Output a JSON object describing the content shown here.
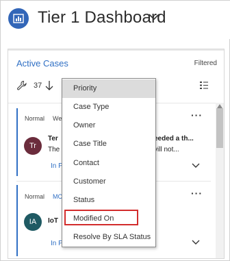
{
  "header": {
    "title": "Tier 1 Dashboard"
  },
  "panel": {
    "title": "Active Cases",
    "filter_status": "Filtered",
    "toolbar": {
      "record_count": "37"
    }
  },
  "cards": [
    {
      "priority": "Normal",
      "owner_fragment": "We",
      "avatar_initials": "Tr",
      "line1_left": "Ter",
      "line1_right": "eeded a th...",
      "line2_left": "The",
      "line2_right": "vill not...",
      "status_fragment": "In P"
    },
    {
      "priority": "Normal",
      "owner_fragment": "MC",
      "avatar_initials": "IA",
      "line1_left": "IoT",
      "status_fragment": "In P"
    }
  ],
  "sort_menu": {
    "items": [
      "Priority",
      "Case Type",
      "Owner",
      "Case Title",
      "Contact",
      "Customer",
      "Status",
      "Modified On",
      "Resolve By SLA Status"
    ],
    "selected_item": "Priority",
    "highlighted_item": "Modified On"
  },
  "colors": {
    "accent": "#2f6fc4",
    "logo": "#3266b8",
    "highlight": "#d22b2b"
  }
}
